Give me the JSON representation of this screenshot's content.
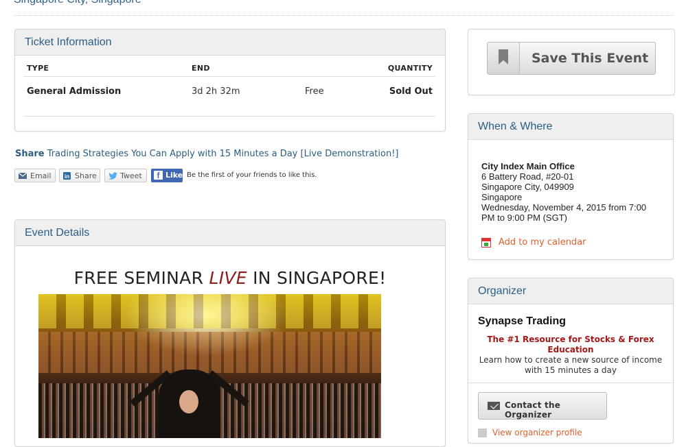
{
  "header": {
    "location": "Singapore City, Singapore"
  },
  "ticket": {
    "title": "Ticket Information",
    "columns": {
      "type": "TYPE",
      "end": "END",
      "quantity": "QUANTITY"
    },
    "rows": [
      {
        "type": "General Admission",
        "end": "3d 2h 32m",
        "price": "Free",
        "quantity": "Sold Out"
      }
    ]
  },
  "share": {
    "label": "Share",
    "event_title": "Trading Strategies You Can Apply with 15 Minutes a Day [Live Demonstration!]",
    "buttons": {
      "email": "Email",
      "share": "Share",
      "tweet": "Tweet",
      "like": "Like"
    },
    "fb_text": "Be the first of your friends to like this."
  },
  "details": {
    "title": "Event Details",
    "headline_pre": "FREE SEMINAR ",
    "headline_live": "LIVE",
    "headline_post": " IN SINGAPORE!"
  },
  "save": {
    "label": "Save This Event"
  },
  "when_where": {
    "title": "When & Where",
    "venue_name": "City Index Main Office",
    "address1": "6 Battery Road, #20-01",
    "address2": "Singapore City, 049909",
    "country": "Singapore",
    "datetime_line1": "Wednesday, November 4, 2015 from 7:00",
    "datetime_line2": "PM to 9:00 PM (SGT)",
    "calendar_link": "Add to my calendar"
  },
  "organizer": {
    "title": "Organizer",
    "name": "Synapse Trading",
    "tagline": "The #1 Resource for Stocks & Forex Education",
    "description": "Learn how to create a new source of income with 15 minutes a day",
    "contact_label": "Contact the Organizer",
    "profile_link": "View organizer profile"
  },
  "colors": {
    "link": "#2c5e84",
    "accent": "#e0602a",
    "tagline": "#a51818",
    "facebook": "#4267b2"
  }
}
